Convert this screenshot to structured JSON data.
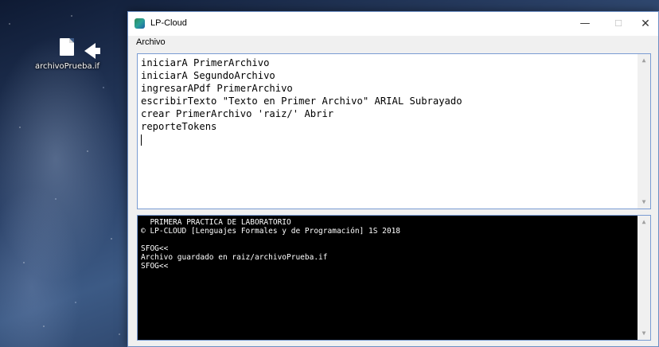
{
  "desktop": {
    "file_label": "archivoPrueba.if"
  },
  "window": {
    "title": "LP-Cloud",
    "min_glyph": "—",
    "max_glyph": "☐",
    "close_glyph": "✕"
  },
  "menu": {
    "archivo": "Archivo"
  },
  "editor": {
    "lines": [
      "iniciarA PrimerArchivo",
      "iniciarA SegundoArchivo",
      "ingresarAPdf PrimerArchivo",
      "escribirTexto \"Texto en Primer Archivo\" ARIAL Subrayado",
      "crear PrimerArchivo 'raiz/' Abrir",
      "reporteTokens"
    ]
  },
  "console": {
    "lines": [
      "  PRIMERA PRACTICA DE LABORATORIO",
      "© LP-CLOUD [Lenguajes Formales y de Programación] 1S 2018",
      "",
      "SFOG<<",
      "Archivo guardado en raiz/archivoPrueba.if",
      "SFOG<<"
    ]
  },
  "scroll": {
    "up": "▲",
    "down": "▼"
  }
}
